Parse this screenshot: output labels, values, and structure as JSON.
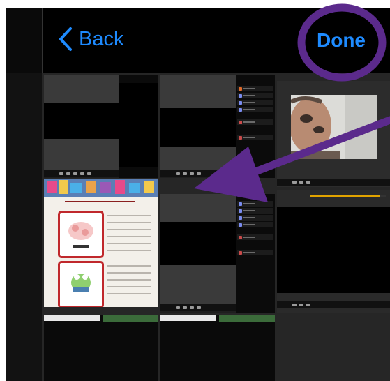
{
  "navbar": {
    "back_label": "Back",
    "done_label": "Done"
  },
  "icons": {
    "back": "chevron-left-icon"
  },
  "colors": {
    "accent": "#1e8bff",
    "annotation": "#5b2a8c",
    "navbar_bg": "#000000",
    "progress": "#e2a400"
  },
  "thumbnails": [
    {
      "name": "screen-recording-1"
    },
    {
      "name": "screen-recording-2"
    },
    {
      "name": "camera-photo-face"
    },
    {
      "name": "worksheet-photo"
    },
    {
      "name": "screen-recording-3"
    },
    {
      "name": "video-clip"
    }
  ],
  "video_progress": 0.92
}
